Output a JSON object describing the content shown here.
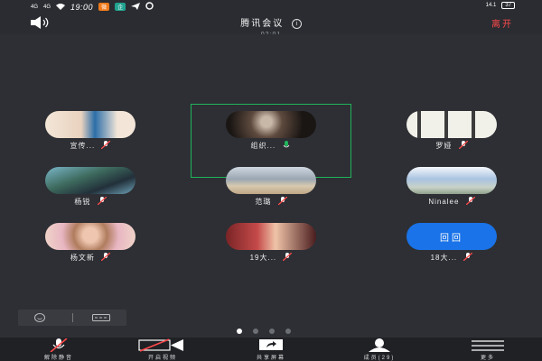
{
  "status_bar": {
    "signal_1": "4G",
    "signal_2": "4G",
    "time": "19:00",
    "badge_1": "微",
    "badge_2": "企",
    "speed": "14.1",
    "battery": "37"
  },
  "header": {
    "title": "腾讯会议",
    "duration": "02:01",
    "leave_label": "离开"
  },
  "participants": [
    {
      "name": "宣传..."
    },
    {
      "name": "组织..."
    },
    {
      "name": "罗娅"
    },
    {
      "name": "杨锐"
    },
    {
      "name": "范璐"
    },
    {
      "name": "Ninalee"
    },
    {
      "name": "杨文新"
    },
    {
      "name": "19大..."
    },
    {
      "name": "18大...",
      "avatar_text": "回回"
    }
  ],
  "toolbar": {
    "unmute_label": "解除静音",
    "video_label": "开启视频",
    "share_label": "共享屏幕",
    "members_label": "成员(29)",
    "more_label": "更多"
  },
  "colors": {
    "accent_green": "#21b35b",
    "leave_red": "#ff4a4a",
    "avatar_blue": "#1a73e8"
  }
}
